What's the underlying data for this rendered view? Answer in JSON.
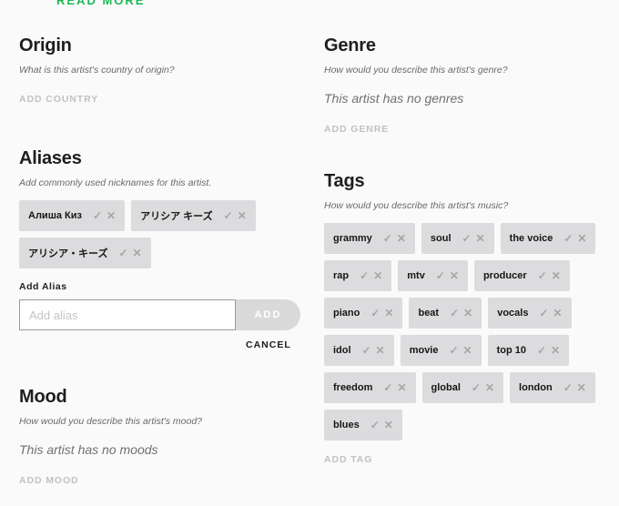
{
  "read_more_label": "READ MORE",
  "origin": {
    "title": "Origin",
    "description": "What is this artist's country of origin?",
    "add_label": "ADD COUNTRY"
  },
  "aliases": {
    "title": "Aliases",
    "description": "Add commonly used nicknames for this artist.",
    "items": [
      {
        "label": "Алиша Киз"
      },
      {
        "label": "アリシア キーズ"
      },
      {
        "label": "アリシア・キーズ"
      }
    ],
    "add_alias_label": "Add Alias",
    "input_value": "",
    "input_placeholder": "Add alias",
    "add_button": "ADD",
    "cancel_button": "CANCEL"
  },
  "mood": {
    "title": "Mood",
    "description": "How would you describe this artist's mood?",
    "empty_note": "This artist has no moods",
    "add_label": "ADD MOOD"
  },
  "genre": {
    "title": "Genre",
    "description": "How would you describe this artist's genre?",
    "empty_note": "This artist has no genres",
    "add_label": "ADD GENRE"
  },
  "tags": {
    "title": "Tags",
    "description": "How would you describe this artist's music?",
    "items": [
      {
        "label": "grammy"
      },
      {
        "label": "soul"
      },
      {
        "label": "the voice"
      },
      {
        "label": "rap"
      },
      {
        "label": "mtv"
      },
      {
        "label": "producer"
      },
      {
        "label": "piano"
      },
      {
        "label": "beat"
      },
      {
        "label": "vocals"
      },
      {
        "label": "idol"
      },
      {
        "label": "movie"
      },
      {
        "label": "top 10"
      },
      {
        "label": "freedom"
      },
      {
        "label": "global"
      },
      {
        "label": "london"
      },
      {
        "label": "blues"
      }
    ],
    "add_label": "ADD TAG"
  },
  "icons": {
    "confirm": "✓",
    "remove": "✕"
  },
  "colors": {
    "accent": "#1db954",
    "chip_bg": "#dcdcde"
  }
}
